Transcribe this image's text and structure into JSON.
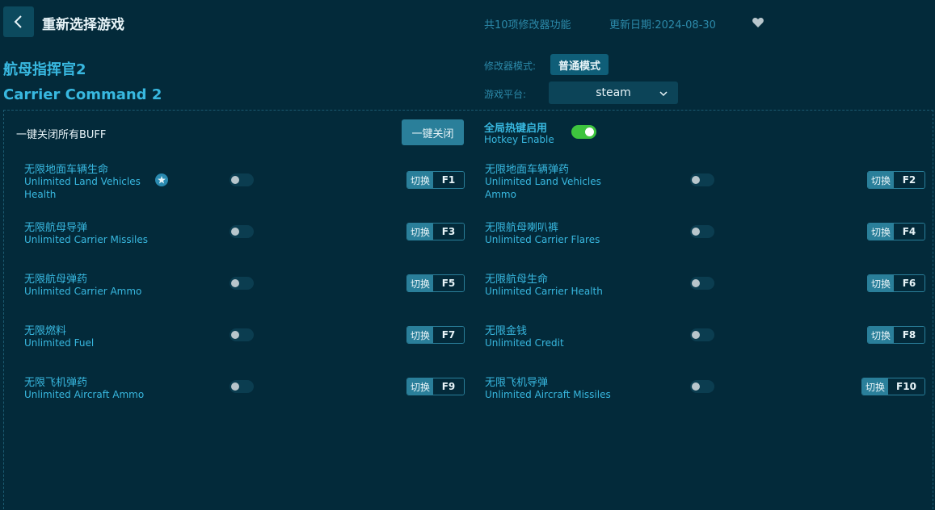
{
  "header": {
    "title": "重新选择游戏",
    "feature_count": "共10项修改器功能",
    "update_date": "更新日期:2024-08-30",
    "favorite_icon": "heart-icon",
    "back_icon": "chevron-left-icon"
  },
  "game": {
    "title_cn": "航母指挥官2",
    "title_en": "Carrier Command 2"
  },
  "settings": {
    "mode_label": "修改器模式:",
    "mode_value": "普通模式",
    "platform_label": "游戏平台:",
    "platform_value": "steam"
  },
  "controls": {
    "close_all_label": "一键关闭所有BUFF",
    "close_all_button": "一键关闭",
    "hotkey_cn": "全局热键启用",
    "hotkey_en": "Hotkey Enable",
    "hotkey_enabled": true
  },
  "colors": {
    "background": "#032a3a",
    "accent": "#38b8e0",
    "toggle_on": "#3ec43e"
  },
  "options": [
    {
      "cn": "无限地面车辆生命",
      "en": "Unlimited Land Vehicles Health",
      "switch": "切换",
      "key": "F1",
      "starred": true,
      "enabled": false
    },
    {
      "cn": "无限地面车辆弹药",
      "en": "Unlimited Land Vehicles Ammo",
      "switch": "切换",
      "key": "F2",
      "enabled": false
    },
    {
      "cn": "无限航母导弹",
      "en": "Unlimited Carrier Missiles",
      "switch": "切换",
      "key": "F3",
      "enabled": false
    },
    {
      "cn": "无限航母喇叭裤",
      "en": "Unlimited Carrier Flares",
      "switch": "切换",
      "key": "F4",
      "enabled": false
    },
    {
      "cn": "无限航母弹药",
      "en": "Unlimited Carrier Ammo",
      "switch": "切换",
      "key": "F5",
      "enabled": false
    },
    {
      "cn": "无限航母生命",
      "en": "Unlimited Carrier Health",
      "switch": "切换",
      "key": "F6",
      "enabled": false
    },
    {
      "cn": "无限燃料",
      "en": "Unlimited Fuel",
      "switch": "切换",
      "key": "F7",
      "enabled": false
    },
    {
      "cn": "无限金钱",
      "en": "Unlimited Credit",
      "switch": "切换",
      "key": "F8",
      "enabled": false
    },
    {
      "cn": "无限飞机弹药",
      "en": "Unlimited Aircraft Ammo",
      "switch": "切换",
      "key": "F9",
      "enabled": false
    },
    {
      "cn": "无限飞机导弹",
      "en": "Unlimited Aircraft Missiles",
      "switch": "切换",
      "key": "F10",
      "enabled": false
    }
  ]
}
